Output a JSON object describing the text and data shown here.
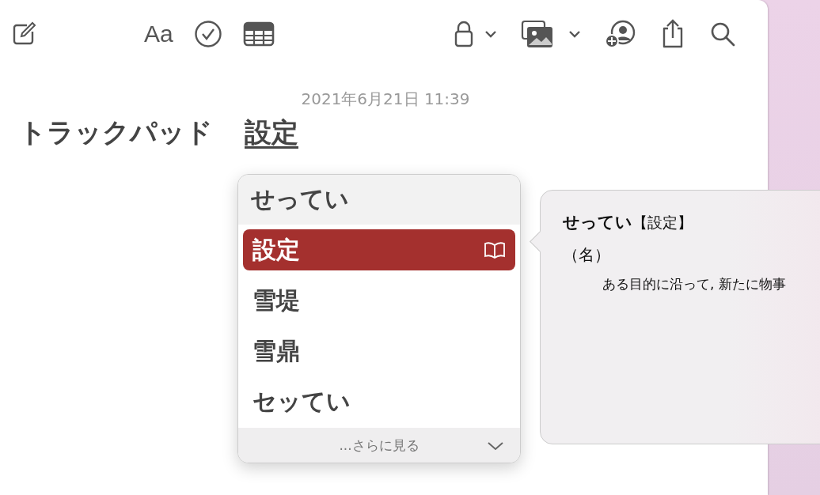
{
  "toolbar": {
    "format_label": "Aa"
  },
  "note": {
    "date": "2021年6月21日 11:39",
    "text": "トラックパッド",
    "marked_word": "設定"
  },
  "candidates": {
    "reading": "せってい",
    "items": [
      {
        "text": "設定",
        "selected": true
      },
      {
        "text": "雪堤",
        "selected": false
      },
      {
        "text": "雪鼎",
        "selected": false
      },
      {
        "text": "セッてい",
        "selected": false
      }
    ],
    "more": "...さらに見る"
  },
  "dictionary": {
    "headword": "せってい",
    "kanji": "【設定】",
    "part_of_speech": "（名）",
    "definition": "ある目的に沿って, 新たに物事"
  }
}
